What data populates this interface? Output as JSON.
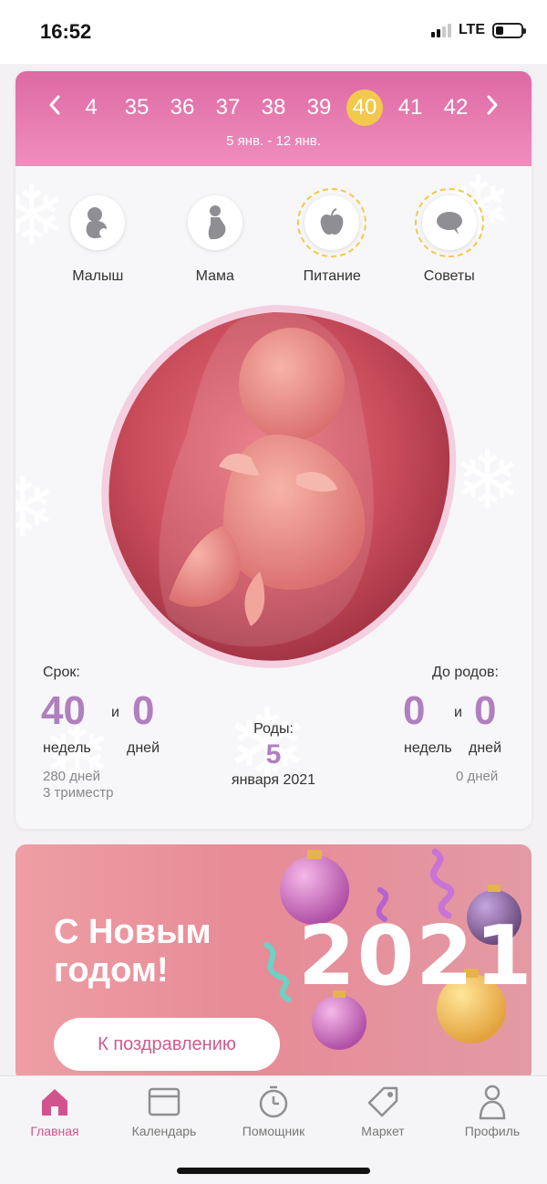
{
  "status": {
    "time": "16:52",
    "network": "LTE"
  },
  "weeks": {
    "prev_icon": "chevron-left-icon",
    "next_icon": "chevron-right-icon",
    "items": [
      "4",
      "35",
      "36",
      "37",
      "38",
      "39",
      "40",
      "41",
      "42"
    ],
    "selected": "40",
    "range": "5 янв. - 12 янв."
  },
  "categories": [
    {
      "label": "Малыш",
      "icon": "baby-icon"
    },
    {
      "label": "Мама",
      "icon": "mother-icon"
    },
    {
      "label": "Питание",
      "icon": "apple-icon"
    },
    {
      "label": "Советы",
      "icon": "speech-bubble-icon"
    }
  ],
  "stats": {
    "term_label": "Срок:",
    "weeks_value": "40",
    "and": "и",
    "days_value": "0",
    "weeks_word": "недель",
    "days_word": "дней",
    "total_days": "280 дней",
    "trimester": "3 триместр",
    "due_label": "Роды:",
    "due_day": "5",
    "due_month_year": "января 2021",
    "left_label": "До родов:",
    "left_weeks": "0",
    "left_days": "0",
    "left_total": "0 дней"
  },
  "banner": {
    "title": "С Новым годом!",
    "year": "2021",
    "button": "К поздравлению"
  },
  "tabs": [
    {
      "label": "Главная",
      "icon": "home-icon",
      "active": true
    },
    {
      "label": "Календарь",
      "icon": "calendar-icon",
      "active": false
    },
    {
      "label": "Помощник",
      "icon": "timer-icon",
      "active": false
    },
    {
      "label": "Маркет",
      "icon": "tag-icon",
      "active": false
    },
    {
      "label": "Профиль",
      "icon": "profile-icon",
      "active": false
    }
  ],
  "colors": {
    "accent": "#d2548d",
    "header_pink": "#e56fab",
    "selected_week": "#f2c94c",
    "stat_number": "#b07fbf"
  }
}
